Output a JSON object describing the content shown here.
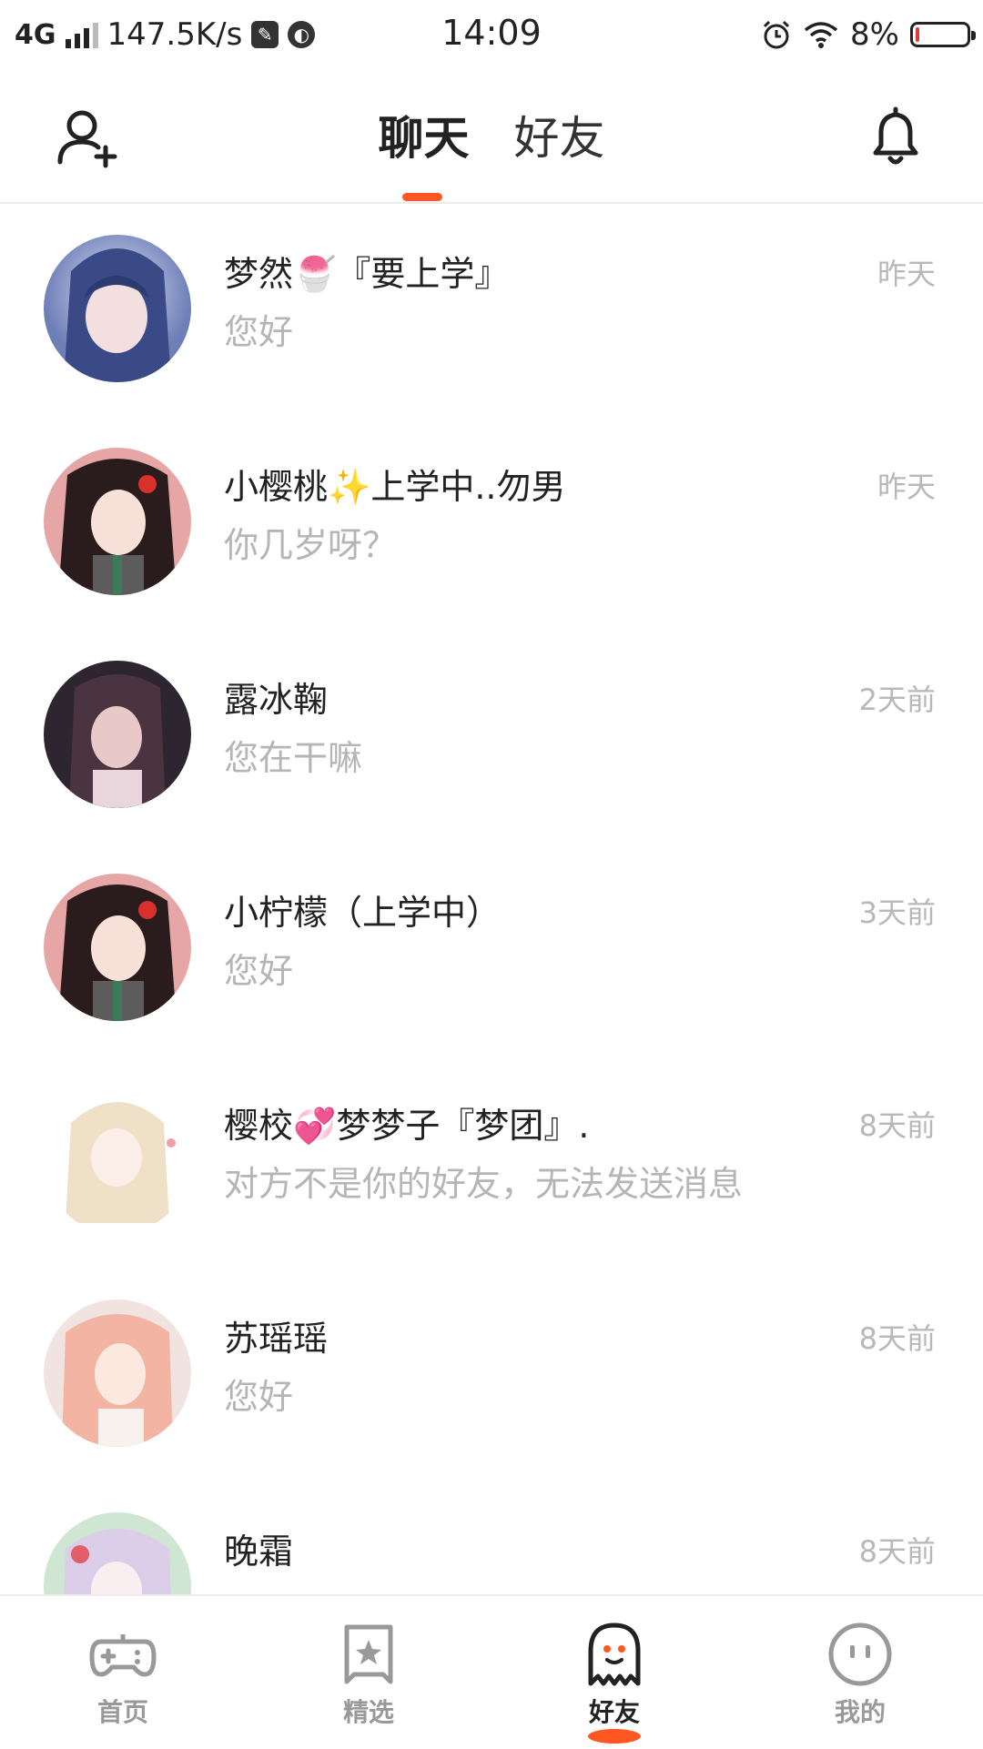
{
  "status_bar": {
    "network": "4G",
    "speed": "147.5K/s",
    "time": "14:09",
    "battery": "8%",
    "battery_level": 0.08,
    "battery_color": "#e53935"
  },
  "header": {
    "tabs": [
      {
        "label": "聊天",
        "active": true
      },
      {
        "label": "好友",
        "active": false
      }
    ],
    "accent_color": "#ff5722",
    "left_icon": "add-user-icon",
    "right_icon": "bell-icon"
  },
  "chats": [
    {
      "name": "梦然🍧『要上学』",
      "message": "您好",
      "time": "昨天"
    },
    {
      "name": "小樱桃✨上学中..勿男",
      "message": "你几岁呀？",
      "time": "昨天"
    },
    {
      "name": "露冰鞠",
      "message": "您在干嘛",
      "time": "2天前"
    },
    {
      "name": "小柠檬（上学中）",
      "message": "您好",
      "time": "3天前"
    },
    {
      "name": "樱校💞梦梦子『梦团』.",
      "message": "对方不是你的好友，无法发送消息",
      "time": "8天前"
    },
    {
      "name": "苏瑶瑶",
      "message": "您好",
      "time": "8天前"
    },
    {
      "name": "晚霜",
      "message": "",
      "time": "8天前"
    }
  ],
  "bottom_nav": [
    {
      "label": "首页",
      "icon": "gamepad-icon",
      "active": false
    },
    {
      "label": "精选",
      "icon": "star-bookmark-icon",
      "active": false
    },
    {
      "label": "好友",
      "icon": "ghost-icon",
      "active": true
    },
    {
      "label": "我的",
      "icon": "face-icon",
      "active": false
    }
  ]
}
